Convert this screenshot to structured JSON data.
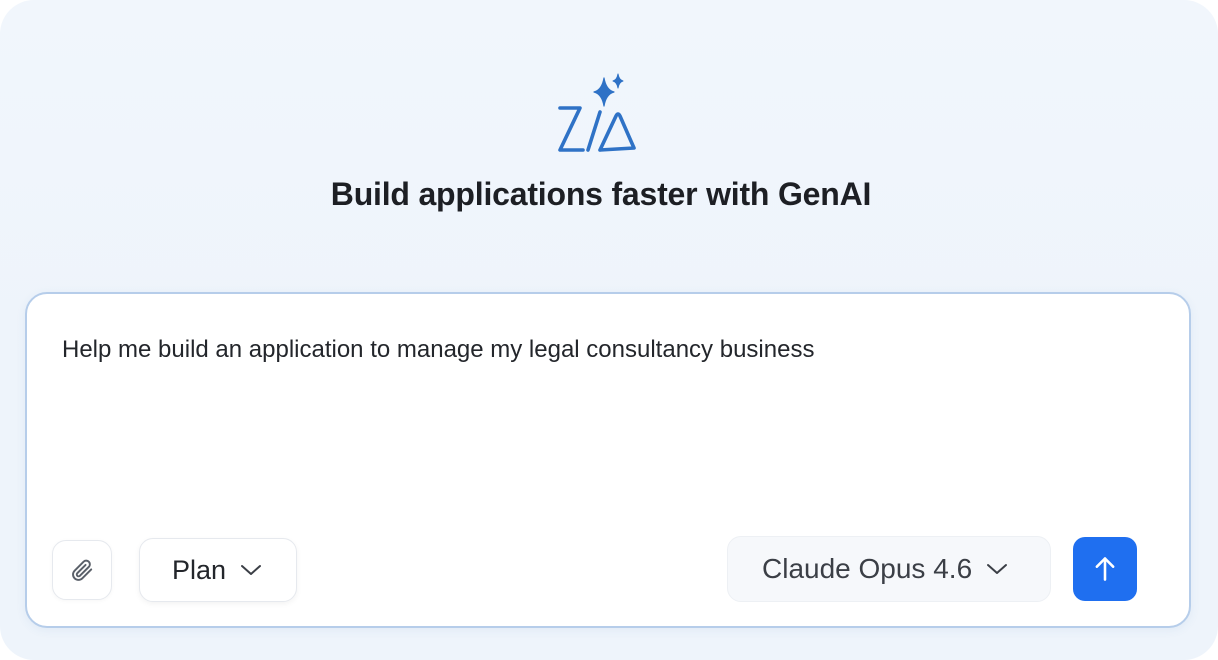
{
  "hero": {
    "logo_icon": "zia-sparkle-logo-icon",
    "headline": "Build applications faster with GenAI"
  },
  "composer": {
    "prompt_value": "Help me build an application to manage my legal consultancy business",
    "attach_icon": "paperclip-icon",
    "mode_label": "Plan",
    "model_label": "Claude Opus 4.6",
    "send_icon": "arrow-up-icon"
  },
  "colors": {
    "accent": "#1f6ff0",
    "logo": "#2f72c6",
    "composer_border": "#b6cdea",
    "background": "#eef4fb"
  }
}
